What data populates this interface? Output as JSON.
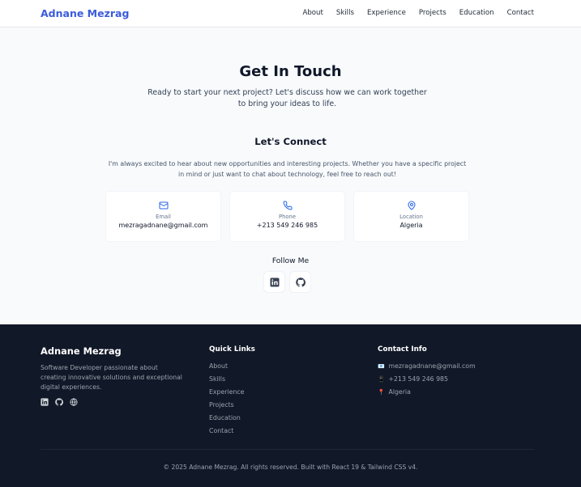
{
  "nav": {
    "brand": "Adnane Mezrag",
    "links": [
      "About",
      "Skills",
      "Experience",
      "Projects",
      "Education",
      "Contact"
    ]
  },
  "hero": {
    "title": "Get In Touch",
    "subtitle": "Ready to start your next project? Let's discuss how we can work together to bring your ideas to life."
  },
  "connect": {
    "title": "Let's Connect",
    "text": "I'm always excited to hear about new opportunities and interesting projects. Whether you have a specific project in mind or just want to chat about technology, feel free to reach out!"
  },
  "cards": [
    {
      "label": "Email",
      "value": "mezragadnane@gmail.com",
      "icon": "mail-icon"
    },
    {
      "label": "Phone",
      "value": "+213 549 246 985",
      "icon": "phone-icon"
    },
    {
      "label": "Location",
      "value": "Algeria",
      "icon": "map-pin-icon"
    }
  ],
  "follow": {
    "title": "Follow Me",
    "icons": [
      "linkedin-icon",
      "github-icon"
    ]
  },
  "footer": {
    "brand": "Adnane Mezrag",
    "description": "Software Developer passionate about creating innovative solutions and exceptional digital experiences.",
    "quick_links_title": "Quick Links",
    "quick_links": [
      "About",
      "Skills",
      "Experience",
      "Projects",
      "Education",
      "Contact"
    ],
    "contact_title": "Contact Info",
    "contact_items": [
      {
        "emoji": "📧",
        "text": "mezragadnane@gmail.com"
      },
      {
        "emoji": "📱",
        "text": "+213 549 246 985"
      },
      {
        "emoji": "📍",
        "text": "Algeria"
      }
    ],
    "copyright": "© 2025 Adnane Mezrag. All rights reserved. Built with React 19 & Tailwind CSS v4."
  },
  "colors": {
    "accent": "#3b5bdb",
    "icon_blue": "#2563eb",
    "footer_bg": "#111827",
    "page_bg": "#f8fafc"
  }
}
